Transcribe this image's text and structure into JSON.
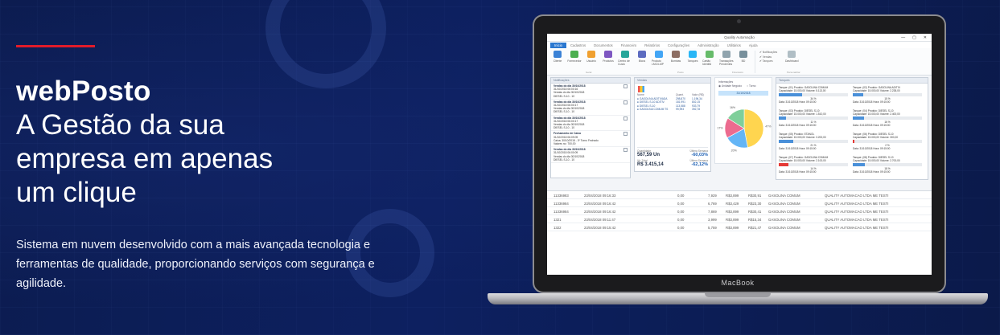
{
  "hero": {
    "brand": "webPosto",
    "headline_line1": "A Gestão da sua",
    "headline_line2": "empresa em apenas",
    "headline_line3": "um clique",
    "description": "Sistema em nuvem desenvolvido com a mais avançada tecnologia e ferramentas de qualidade, proporcionando serviços com segurança e agilidade.",
    "accent_color": "#e11b2a"
  },
  "laptop": {
    "model_label": "MacBook"
  },
  "app": {
    "window_title": "Quality Automação",
    "window_buttons": [
      "—",
      "▢",
      "✕"
    ],
    "menu_tabs": [
      "Início",
      "Cadastros",
      "Documentos",
      "Financeiro",
      "Relatórios",
      "Configurações",
      "Administração",
      "Utilitários",
      "Ajuda"
    ],
    "active_menu": "Início",
    "ribbon_buttons": [
      {
        "label": "Cliente",
        "color": "#3b82d6"
      },
      {
        "label": "Fornecedor",
        "color": "#4caf50"
      },
      {
        "label": "Usuário",
        "color": "#f0a030"
      },
      {
        "label": "Produtos",
        "color": "#7e57c2"
      },
      {
        "label": "Centro de Custo",
        "color": "#26a69a"
      },
      {
        "label": "Bicos",
        "color": "#5c6bc0"
      },
      {
        "label": "Produto LMC/LMP",
        "color": "#42a5f5"
      },
      {
        "label": "Bombas",
        "color": "#8d6e63"
      },
      {
        "label": "Tanques",
        "color": "#29b6f6"
      },
      {
        "label": "Cartão Identfid",
        "color": "#66bb6a"
      },
      {
        "label": "Transações Pendentes",
        "color": "#90a4ae"
      },
      {
        "label": "BD",
        "color": "#78909c"
      }
    ],
    "ribbon_checks": [
      "Notificações",
      "Vendas",
      "Tanques"
    ],
    "dashboard_label": "Dashboard",
    "ribbon_groups": [
      "Geral",
      "Posto",
      "Financeiro",
      "Personalizar"
    ],
    "notifications_panel": {
      "title": "Notificações",
      "items": [
        {
          "title": "Vendas do dia 30/10/2018",
          "lines": [
            "31/10/2018 06:00:16",
            "Vendas do dia 30/10/2018",
            "DIESEL S-10 - 10"
          ]
        },
        {
          "title": "Vendas do dia 30/10/2018",
          "lines": [
            "31/10/2018 06:00:17",
            "Vendas do dia 30/10/2018",
            "DIESEL S-10 - 10"
          ]
        },
        {
          "title": "Vendas do dia 30/10/2018",
          "lines": [
            "31/10/2018 06:00:17",
            "Vendas do dia 30/10/2018",
            "DIESEL S-10 - 10"
          ]
        },
        {
          "title": "Fechamento de Caixa",
          "lines": [
            "31/10/2018 06:09:09",
            "Caixa: 30/10/2018 - 3º Turno Fechado",
            "Valores no: 700,00"
          ]
        },
        {
          "title": "Vendas do dia 30/10/2018",
          "lines": [
            "31/10/2018 06:00:09",
            "Vendas do dia 30/10/2018",
            "DIESEL S-10 - 10"
          ]
        }
      ]
    },
    "sales_panel": {
      "title": "Vendas",
      "columns": [
        "Nome",
        "Quant.",
        "Valor (R$)"
      ],
      "rows": [
        [
          "GASOLINA ADITIVADA",
          "298,870",
          "1.196,34"
        ],
        [
          "DIESEL S-10 ADITIV.",
          "181,991",
          "802,15"
        ],
        [
          "DIESEL S-10",
          "113,588",
          "933,79"
        ],
        [
          "GASOLINA COMUM TS",
          "99,993",
          "392,78"
        ]
      ],
      "quantity_label": "Quantidade",
      "quantity_value": "567,59 Un",
      "last_week_label": "Última Semana",
      "last_week_qty": "-60,03%",
      "total_label": "Vlr. Total",
      "total_value": "R$ 3.415,14",
      "last_week_total": "-62,12%"
    },
    "pie_panel": {
      "info_label": "Informações",
      "option_business_unit": "Unidade Negócio",
      "option_shift": "Turno",
      "date_label": "31/10/2018",
      "slices": [
        {
          "label": "GASOLINA ADITIVADA",
          "value": 47,
          "color": "#ffd54f"
        },
        {
          "label": "DIESEL S-10 ADITIV.",
          "value": 20,
          "color": "#64b5f6"
        },
        {
          "label": "DIESEL S-10",
          "value": 17,
          "color": "#ec6b8f"
        },
        {
          "label": "GASOLINA COMUM TS",
          "value": 16,
          "color": "#7fcf9a"
        }
      ],
      "slice_labels": [
        "47%",
        "20%",
        "17%",
        "16%"
      ]
    },
    "tanks_panel": {
      "title": "Tanques",
      "tanks": [
        {
          "tank": "Tanque: (01)",
          "product": "Produto: GASOLINA COMUM",
          "capacity": "Capacidade: 15.000,00",
          "volume": "Volume: 5.113,00",
          "pct": 34,
          "pct_label": "34 %",
          "date": "Data: 31/10/2018",
          "time": "Hora: 09:15:00",
          "red": false
        },
        {
          "tank": "Tanque: (02)",
          "product": "Produto: GASOLINA ADITIV.",
          "capacity": "Capacidade: 15.000,00",
          "volume": "Volume: 2.238,00",
          "pct": 15,
          "pct_label": "15 %",
          "date": "Data: 31/10/2018",
          "time": "Hora: 09:15:00",
          "red": false
        },
        {
          "tank": "Tanque: (03)",
          "product": "Produto: DIESEL S-10",
          "capacity": "Capacidade: 15.000,00",
          "volume": "Volume: 1.510,00",
          "pct": 11,
          "pct_label": "11 %",
          "date": "Data: 31/10/2018",
          "time": "Hora: 09:15:00",
          "red": false
        },
        {
          "tank": "Tanque: (04)",
          "product": "Produto: DIESEL S-10",
          "capacity": "Capacidade: 15.000,00",
          "volume": "Volume: 2.400,00",
          "pct": 16,
          "pct_label": "16 %",
          "date": "Data: 31/10/2018",
          "time": "Hora: 09:15:00",
          "red": false
        },
        {
          "tank": "Tanque: (05)",
          "product": "Produto: ETANOL",
          "capacity": "Capacidade: 15.000,00",
          "volume": "Volume: 3.200,00",
          "pct": 21,
          "pct_label": "21 %",
          "date": "Data: 31/10/2018",
          "time": "Hora: 09:15:00",
          "red": false
        },
        {
          "tank": "Tanque: (06)",
          "product": "Produto: DIESEL S-10",
          "capacity": "Capacidade: 15.000,00",
          "volume": "Volume: 300,00",
          "pct": 2,
          "pct_label": "2 %",
          "date": "Data: 31/10/2018",
          "time": "Hora: 09:15:00",
          "red": true
        },
        {
          "tank": "Tanque: (07)",
          "product": "Produto: GASOLINA COMUM",
          "capacity": "Capacidade: 15.000,00",
          "volume": "Volume: 2.100,00",
          "pct": 14,
          "pct_label": "14 %",
          "date": "Data: 31/10/2018",
          "time": "Hora: 09:15:00",
          "red": true
        },
        {
          "tank": "Tanque: (08)",
          "product": "Produto: DIESEL S-10",
          "capacity": "Capacidade: 15.000,00",
          "volume": "Volume: 2.700,00",
          "pct": 18,
          "pct_label": "18 %",
          "date": "Data: 31/10/2018",
          "time": "Hora: 09:15:00",
          "red": false
        }
      ]
    },
    "grid_rows": [
      [
        "11336983",
        "23/04/2018 09:16:33",
        "0,00",
        "7,929",
        "R$3,899",
        "R$30,91",
        "GASOLINA COMUM",
        "QUALITY AUTOMACAO LTDA ME TESTI"
      ],
      [
        "11336984",
        "23/04/2018 09:16:42",
        "0,00",
        "6,769",
        "R$3,429",
        "R$23,30",
        "GASOLINA COMUM",
        "QUALITY AUTOMACAO LTDA ME TESTI"
      ],
      [
        "11336984",
        "23/04/2018 09:16:42",
        "0,00",
        "7,869",
        "R$3,899",
        "R$30,41",
        "GASOLINA COMUM",
        "QUALITY AUTOMACAO LTDA ME TESTI"
      ],
      [
        "1321",
        "23/04/2018 09:11:47",
        "0,00",
        "3,999",
        "R$3,899",
        "R$15,34",
        "GASOLINA COMUM",
        "QUALITY AUTOMACAO LTDA ME TESTI"
      ],
      [
        "1322",
        "23/04/2018 09:15:42",
        "0,00",
        "5,759",
        "R$3,899",
        "R$21,47",
        "GASOLINA COMUM",
        "QUALITY AUTOMACAO LTDA ME TESTI"
      ]
    ]
  }
}
